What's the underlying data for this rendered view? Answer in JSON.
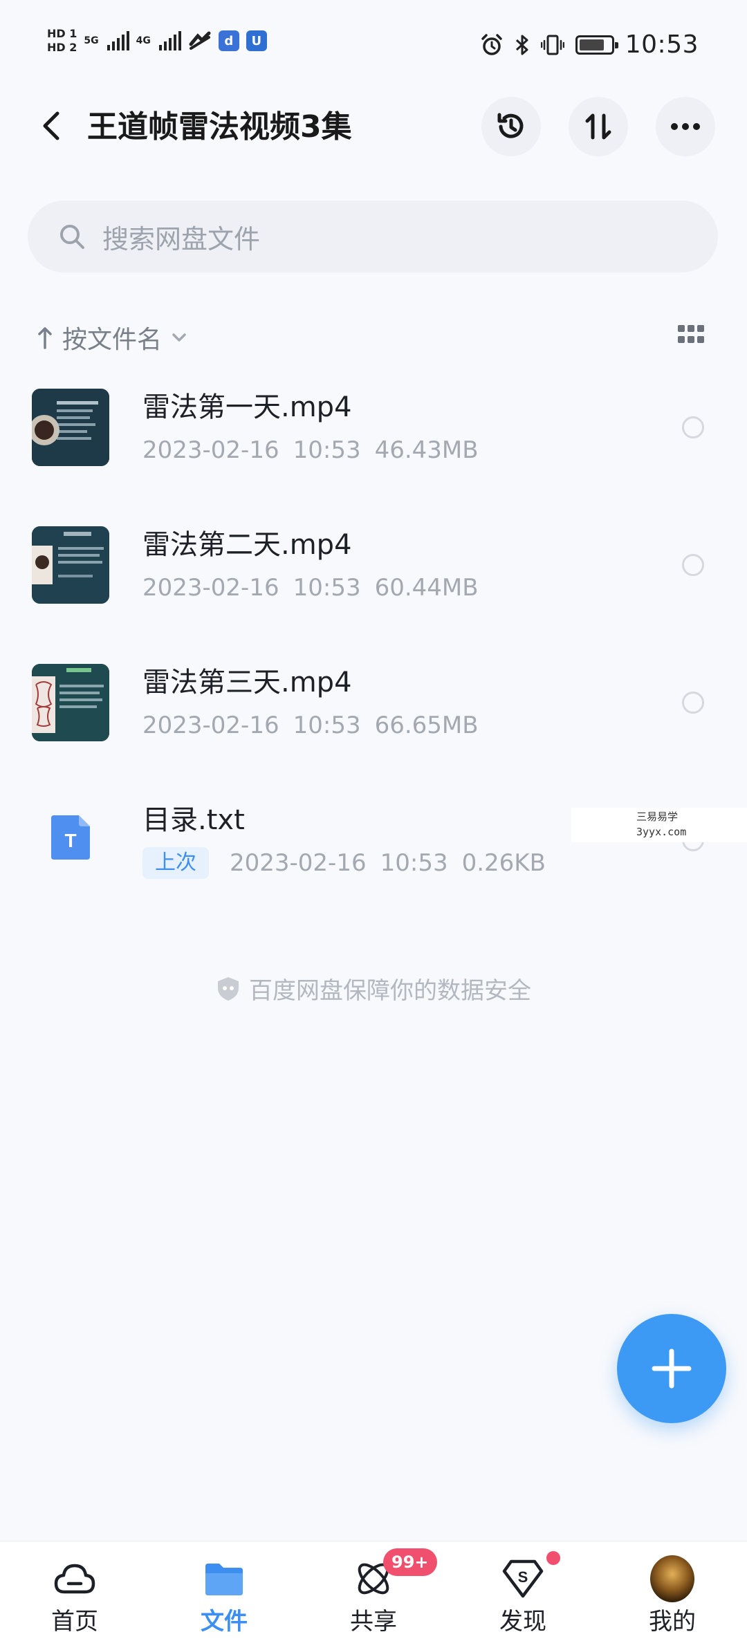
{
  "status_bar": {
    "hd1": "HD 1",
    "hd2": "HD 2",
    "net1": "5G",
    "net2": "4G",
    "time": "10:53"
  },
  "header": {
    "title": "王道帧雷法视频3集"
  },
  "search": {
    "placeholder": "搜索网盘文件"
  },
  "sort": {
    "label": "按文件名"
  },
  "files": [
    {
      "name": "雷法第一天.mp4",
      "date": "2023-02-16",
      "time": "10:53",
      "size": "46.43MB",
      "type": "video"
    },
    {
      "name": "雷法第二天.mp4",
      "date": "2023-02-16",
      "time": "10:53",
      "size": "60.44MB",
      "type": "video"
    },
    {
      "name": "雷法第三天.mp4",
      "date": "2023-02-16",
      "time": "10:53",
      "size": "66.65MB",
      "type": "video"
    },
    {
      "name": "目录.txt",
      "badge": "上次",
      "date": "2023-02-16",
      "time": "10:53",
      "size": "0.26KB",
      "type": "txt",
      "icon_letter": "T"
    }
  ],
  "watermark": {
    "line1": "三易易学",
    "line2": "3yyx.com"
  },
  "footer": {
    "security_text": "百度网盘保障你的数据安全"
  },
  "bottom_nav": {
    "items": [
      {
        "label": "首页",
        "icon": "cloud-icon"
      },
      {
        "label": "文件",
        "icon": "folder-icon",
        "active": true
      },
      {
        "label": "共享",
        "icon": "share-atom-icon",
        "badge": "99+"
      },
      {
        "label": "发现",
        "icon": "discover-icon",
        "dot": true
      },
      {
        "label": "我的",
        "icon": "avatar"
      }
    ]
  },
  "colors": {
    "accent": "#3c8ff0",
    "fab": "#3c9af5",
    "badge": "#f0506e",
    "background": "#f8f9fc"
  }
}
